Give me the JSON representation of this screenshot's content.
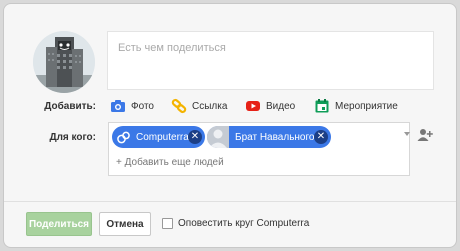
{
  "compose": {
    "placeholder": "Есть чем поделиться"
  },
  "attach": {
    "label": "Добавить:",
    "items": [
      {
        "label": "Фото",
        "icon": "camera-icon",
        "color": "#3b78e7"
      },
      {
        "label": "Ссылка",
        "icon": "link-icon",
        "color": "#f4b400"
      },
      {
        "label": "Видео",
        "icon": "youtube-icon",
        "color": "#e62117"
      },
      {
        "label": "Мероприятие",
        "icon": "calendar-icon",
        "color": "#0f9d58"
      }
    ]
  },
  "audience": {
    "label": "Для кого:",
    "chips": [
      {
        "label": "Computerra",
        "icon": "circles-icon"
      },
      {
        "label": "Брат Навального",
        "icon": "user-photo"
      }
    ],
    "add_more": "+ Добавить еще людей"
  },
  "footer": {
    "share_label": "Поделиться",
    "cancel_label": "Отмена",
    "notify_label": "Оповестить круг Computerra"
  },
  "colors": {
    "accent": "#3b78e7",
    "share_button": "#a8d29e",
    "chip_close": "#1c3f86"
  }
}
